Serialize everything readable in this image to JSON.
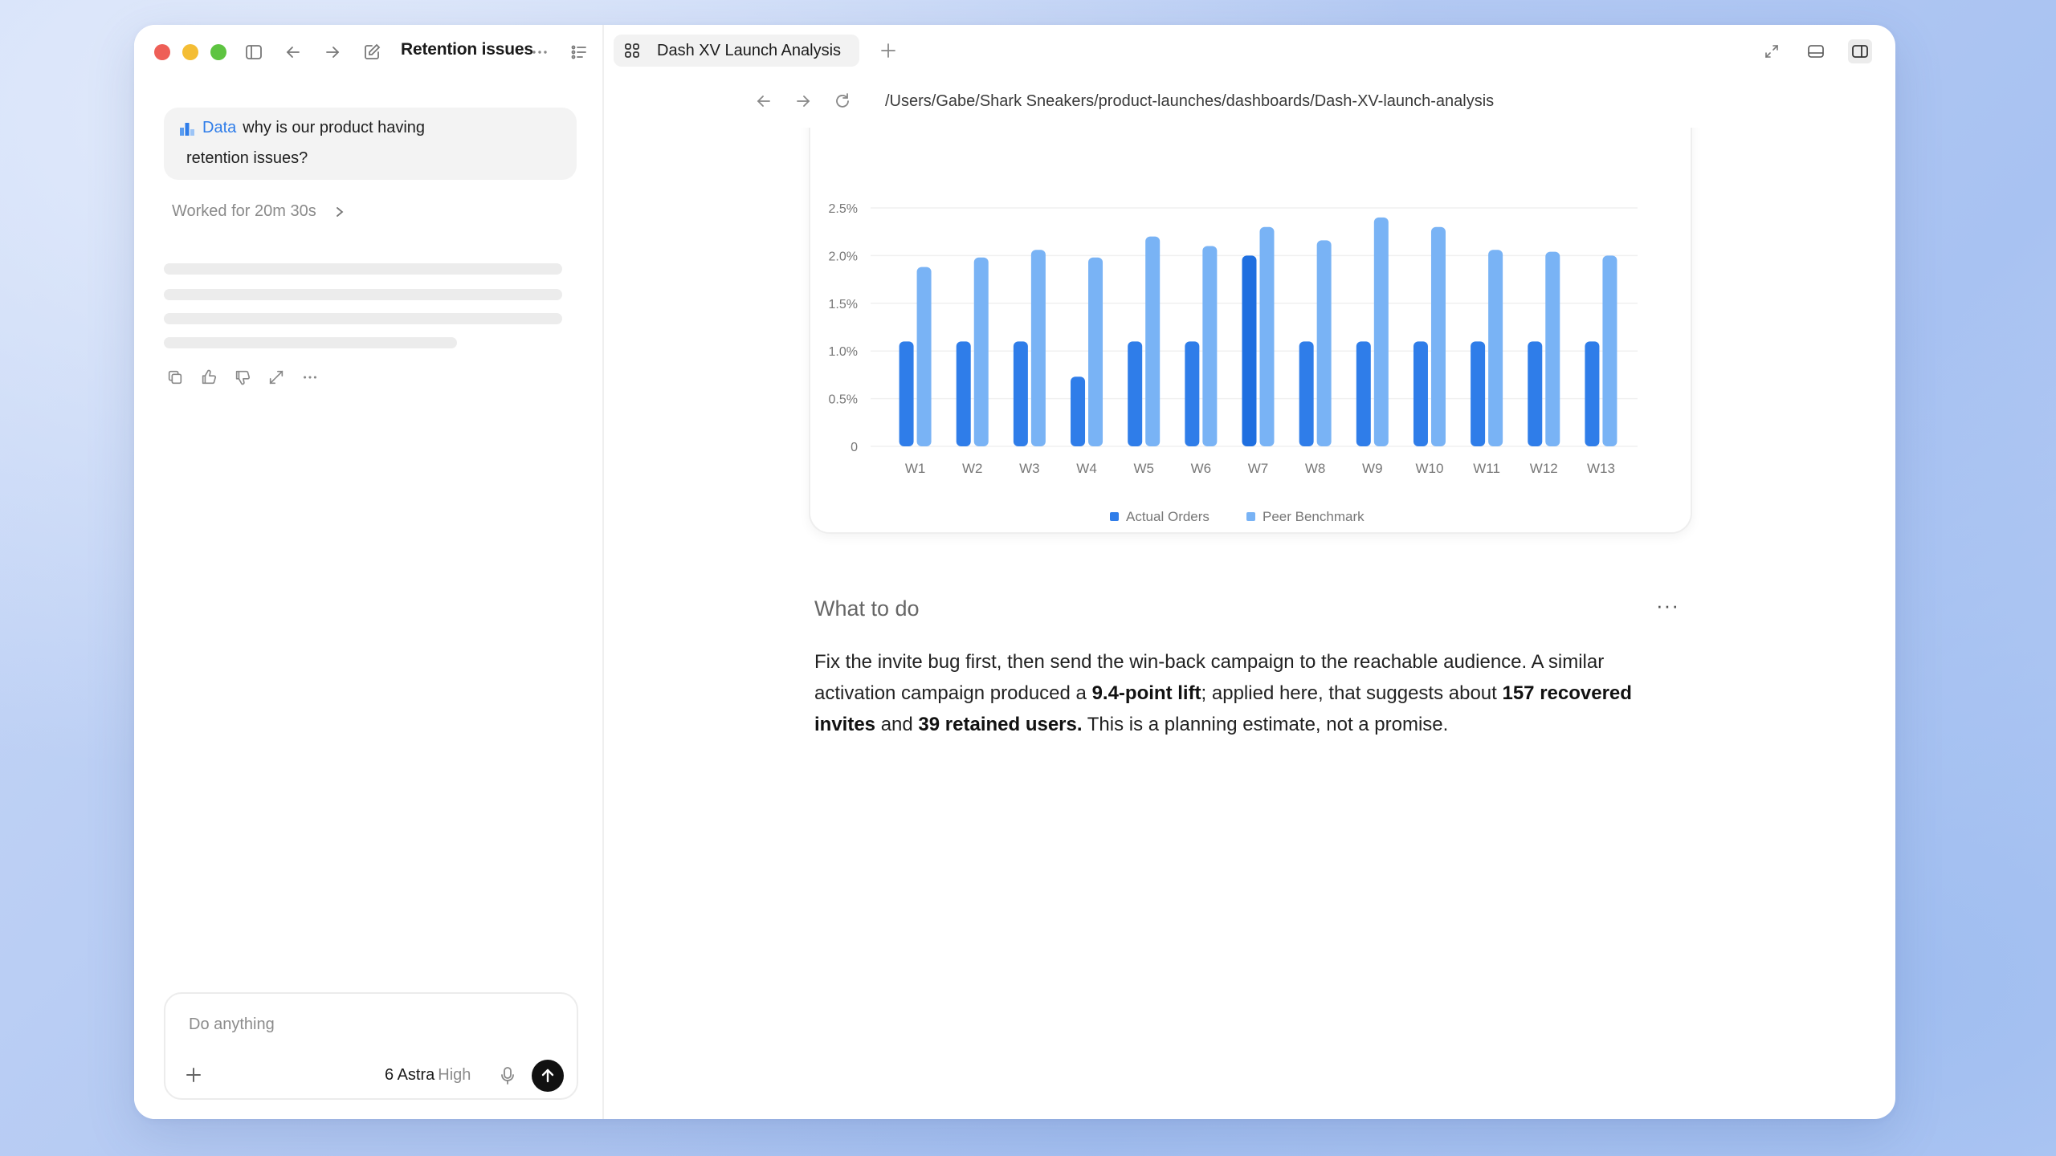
{
  "sidebar": {
    "thread_title": "Retention issues",
    "user_message": {
      "chip": "Data",
      "line1": "why is our product having",
      "line2": "retention issues?"
    },
    "worked_for": "Worked for 20m 30s"
  },
  "composer": {
    "placeholder": "Do anything",
    "model": "6 Astra",
    "level": "High"
  },
  "tab": {
    "label": "Dash XV Launch Analysis"
  },
  "address": {
    "url": "/Users/Gabe/Shark Sneakers/product-launches/dashboards/Dash-XV-launch-analysis"
  },
  "colors": {
    "actual": "#2f7de9",
    "benchmark": "#79b3f5",
    "actual_highlight": "#1f6fe0"
  },
  "icons": [
    "sidebar-toggle-icon",
    "back-arrow-icon",
    "forward-arrow-icon",
    "compose-icon",
    "more-icon",
    "list-icon",
    "grid-icon",
    "plus-icon",
    "expand-icon",
    "panel-bottom-icon",
    "panel-right-icon",
    "refresh-icon",
    "copy-icon",
    "thumbs-up-icon",
    "thumbs-down-icon",
    "share-icon",
    "mic-icon",
    "send-arrow-icon",
    "chevron-right-icon"
  ],
  "chart_data": {
    "type": "bar",
    "categories": [
      "W1",
      "W2",
      "W3",
      "W4",
      "W5",
      "W6",
      "W7",
      "W8",
      "W9",
      "W10",
      "W11",
      "W12",
      "W13"
    ],
    "series": [
      {
        "name": "Actual Orders",
        "values": [
          1.1,
          1.1,
          1.1,
          0.73,
          1.1,
          1.1,
          2.0,
          1.1,
          1.1,
          1.1,
          1.1,
          1.1,
          1.1
        ]
      },
      {
        "name": "Peer Benchmark",
        "values": [
          1.88,
          1.98,
          2.06,
          1.98,
          2.2,
          2.1,
          2.3,
          2.16,
          2.4,
          2.3,
          2.06,
          2.04,
          2.0
        ]
      }
    ],
    "yticks": [
      "0",
      "0.5%",
      "1.0%",
      "1.5%",
      "2.0%",
      "2.5%"
    ],
    "ylim": [
      0,
      2.5
    ],
    "grid": true,
    "legend": "bottom-center"
  },
  "section": {
    "title": "What to do",
    "more": "···",
    "p1": "Fix the invite bug first, then send the win-back campaign to the reachable audience. A similar activation campaign produced a ",
    "b1": "9.4-point lift",
    "p2": "; applied here, that suggests about ",
    "b2": "157 recovered invites",
    "p3": " and ",
    "b3": "39 retained users.",
    "p4": " This is a planning estimate, not a promise."
  }
}
